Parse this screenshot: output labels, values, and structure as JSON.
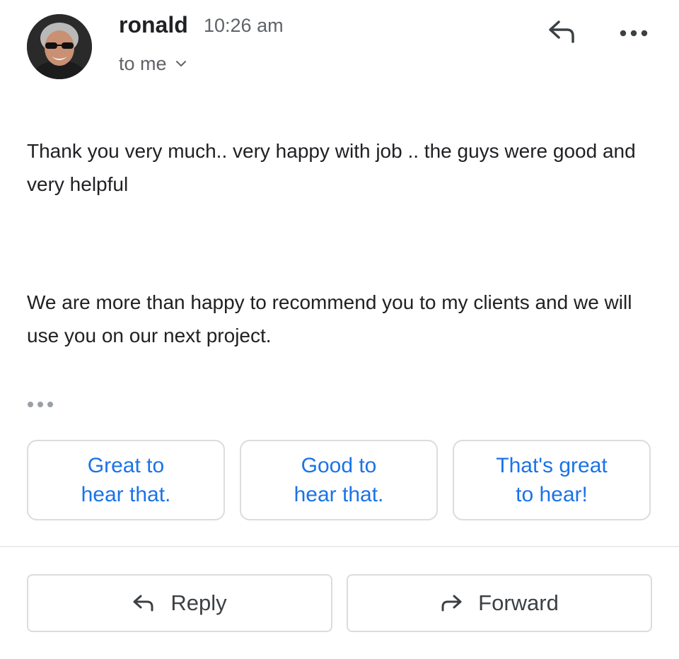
{
  "message": {
    "sender_name": "ronald",
    "time": "10:26 am",
    "recipient_label": "to me",
    "paragraphs": [
      "Thank you very much.. very happy with job .. the guys were good and very helpful",
      "We are more than happy to recommend you to my clients and we will use you on our next project."
    ]
  },
  "smart_replies": [
    {
      "label": "Great to hear that."
    },
    {
      "label": "Good to hear that."
    },
    {
      "label": "That's great to hear!"
    }
  ],
  "actions": {
    "reply_label": "Reply",
    "forward_label": "Forward"
  },
  "icons": {
    "header_reply": "reply-icon",
    "header_more": "more-horizontal-icon",
    "recipient_toggle": "chevron-down-icon",
    "trimmed_content": "ellipsis-icon",
    "reply_button": "reply-icon",
    "forward_button": "forward-icon",
    "avatar": "avatar"
  },
  "colors": {
    "accent": "#1a73e8",
    "text_primary": "#202124",
    "text_secondary": "#5f6368",
    "border": "#dadce0"
  }
}
